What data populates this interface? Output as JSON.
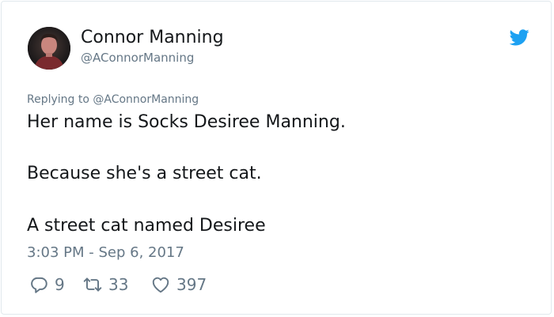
{
  "author": {
    "display_name": "Connor Manning",
    "handle": "@AConnorManning",
    "avatar_icon": "profile-photo"
  },
  "brand": {
    "icon": "twitter-bird-icon",
    "color": "#1da1f2"
  },
  "reply_context": "Replying to @AConnorManning",
  "tweet": {
    "lines": [
      "Her name is Socks Desiree Manning.",
      "Because she's a street cat.",
      "A street cat named Desiree"
    ],
    "timestamp": "3:03 PM - Sep 6, 2017"
  },
  "actions": {
    "replies": {
      "icon": "reply-icon",
      "count": "9"
    },
    "retweets": {
      "icon": "retweet-icon",
      "count": "33"
    },
    "likes": {
      "icon": "heart-icon",
      "count": "397"
    }
  },
  "colors": {
    "text_primary": "#14171a",
    "text_secondary": "#657786",
    "border": "#e1e8ed"
  }
}
